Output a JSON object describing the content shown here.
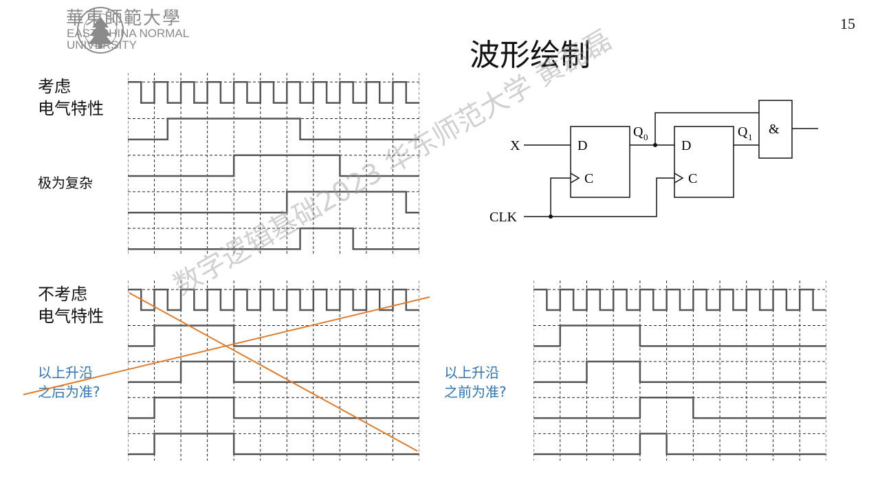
{
  "header": {
    "university_cn": "華東師範大學",
    "university_en_line1": "EAST CHINA NORMAL",
    "university_en_line2": "UNIVERSITY",
    "seal_text": "EAST CHINA NORMAL UNIVERSITY",
    "page_number": "15"
  },
  "title": "波形绘制",
  "labels": {
    "consider_1": "考虑",
    "consider_2": "电气特性",
    "complex": "极为复杂",
    "not_consider_1": "不考虑",
    "not_consider_2": "电气特性",
    "after_edge_1": "以上升沿",
    "after_edge_2": "之后为准?",
    "before_edge_1": "以上升沿",
    "before_edge_2": "之前为准?"
  },
  "circuit": {
    "x_label": "X",
    "clk_label": "CLK",
    "ff1_d": "D",
    "ff1_c": "C",
    "ff1_q": "Q",
    "ff1_q_sub": "0",
    "ff2_d": "D",
    "ff2_c": "C",
    "ff2_q": "Q",
    "ff2_q_sub": "1",
    "and_label": "&"
  },
  "watermark": "数字逻辑基础2023 华东师范大学 黄磊磊",
  "colors": {
    "wave": "#555555",
    "grid": "#222222",
    "cross": "#e07b2a",
    "blue_text": "#2e75b6"
  },
  "waveforms": {
    "top_left": {
      "slots": 11,
      "rows": [
        [
          1,
          0,
          1,
          0,
          1,
          0,
          1,
          0,
          1,
          0,
          1,
          0,
          1,
          0,
          1,
          0,
          1,
          0,
          1,
          0,
          1,
          0
        ],
        [
          0,
          0,
          0,
          1,
          1,
          1,
          1,
          1,
          1,
          1,
          1,
          1,
          1,
          0,
          0,
          0,
          0,
          0,
          0,
          0,
          0,
          0
        ],
        [
          0,
          0,
          0,
          0,
          0,
          0,
          0,
          0,
          1,
          1,
          1,
          1,
          1,
          1,
          1,
          1,
          0,
          0,
          0,
          0,
          0,
          0
        ],
        [
          0,
          0,
          0,
          0,
          0,
          0,
          0,
          0,
          0,
          0,
          0,
          0,
          1,
          1,
          1,
          1,
          1,
          1,
          1,
          1,
          1,
          0
        ],
        [
          0,
          0,
          0,
          0,
          0,
          0,
          0,
          0,
          0,
          0,
          0,
          0,
          0,
          1,
          1,
          1,
          1,
          0,
          0,
          0,
          0,
          0
        ]
      ]
    },
    "bottom_left": {
      "slots": 11,
      "rows": [
        [
          1,
          0,
          1,
          0,
          1,
          0,
          1,
          0,
          1,
          0,
          1,
          0,
          1,
          0,
          1,
          0,
          1,
          0,
          1,
          0,
          1,
          0
        ],
        [
          0,
          0,
          1,
          1,
          1,
          1,
          1,
          1,
          0,
          0,
          0,
          0,
          0,
          0,
          0,
          0,
          0,
          0,
          0,
          0,
          0,
          0
        ],
        [
          0,
          0,
          0,
          0,
          1,
          1,
          1,
          1,
          0,
          0,
          0,
          0,
          0,
          0,
          0,
          0,
          0,
          0,
          0,
          0,
          0,
          0
        ],
        [
          0,
          0,
          1,
          1,
          1,
          1,
          1,
          1,
          0,
          0,
          0,
          0,
          0,
          0,
          0,
          0,
          0,
          0,
          0,
          0,
          0,
          0
        ],
        [
          0,
          0,
          1,
          1,
          1,
          1,
          1,
          1,
          0,
          0,
          0,
          0,
          0,
          0,
          0,
          0,
          0,
          0,
          0,
          0,
          0,
          0
        ]
      ]
    },
    "bottom_right": {
      "slots": 11,
      "rows": [
        [
          1,
          0,
          1,
          0,
          1,
          0,
          1,
          0,
          1,
          0,
          1,
          0,
          1,
          0,
          1,
          0,
          1,
          0,
          1,
          0,
          1,
          0
        ],
        [
          0,
          0,
          1,
          1,
          1,
          1,
          1,
          1,
          0,
          0,
          0,
          0,
          0,
          0,
          0,
          0,
          0,
          0,
          0,
          0,
          0,
          0
        ],
        [
          0,
          0,
          0,
          0,
          1,
          1,
          1,
          1,
          0,
          0,
          0,
          0,
          0,
          0,
          0,
          0,
          0,
          0,
          0,
          0,
          0,
          0
        ],
        [
          0,
          0,
          0,
          0,
          0,
          0,
          0,
          0,
          1,
          1,
          1,
          1,
          0,
          0,
          0,
          0,
          0,
          0,
          0,
          0,
          0,
          0
        ],
        [
          0,
          0,
          0,
          0,
          0,
          0,
          0,
          0,
          1,
          1,
          0,
          0,
          0,
          0,
          0,
          0,
          0,
          0,
          0,
          0,
          0,
          0
        ]
      ]
    }
  }
}
